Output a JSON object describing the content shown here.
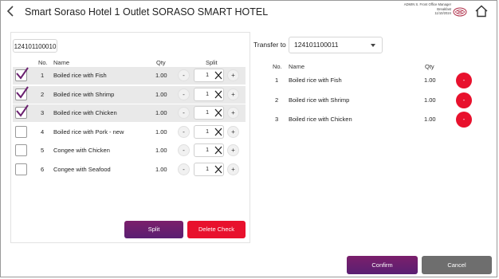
{
  "header": {
    "title": "Smart Soraso Hotel 1 Outlet SORASO SMART HOTEL",
    "user_line": "ADMIN S. Front Office Manager",
    "meal": "Breakfast",
    "date": "11/10/2024",
    "icons": {
      "back": "chevron-left-icon",
      "logo": "soraso-logo-icon",
      "home": "home-icon"
    }
  },
  "left": {
    "check_number": "124101100010",
    "columns": {
      "no": "No.",
      "name": "Name",
      "qty": "Qty",
      "split": "Split"
    },
    "rows": [
      {
        "no": "1",
        "name": "Boiled rice with Fish",
        "qty": "1.00",
        "split": "1",
        "checked": true
      },
      {
        "no": "2",
        "name": "Boiled rice with Shrimp",
        "qty": "1.00",
        "split": "1",
        "checked": true
      },
      {
        "no": "3",
        "name": "Boiled rice with Chicken",
        "qty": "1.00",
        "split": "1",
        "checked": true
      },
      {
        "no": "4",
        "name": "Boiled rice with Pork - new",
        "qty": "1.00",
        "split": "1",
        "checked": false
      },
      {
        "no": "5",
        "name": "Congee with Chicken",
        "qty": "1.00",
        "split": "1",
        "checked": false
      },
      {
        "no": "6",
        "name": "Congee with Seafood",
        "qty": "1.00",
        "split": "1",
        "checked": false
      }
    ],
    "minus_label": "-",
    "plus_label": "+",
    "split_button": "Split",
    "delete_button": "Delete Check"
  },
  "right": {
    "transfer_label": "Transfer to",
    "transfer_value": "124101100011",
    "columns": {
      "no": "No.",
      "name": "Name",
      "qty": "Qty"
    },
    "rows": [
      {
        "no": "1",
        "name": "Boiled rice with Fish",
        "qty": "1.00"
      },
      {
        "no": "2",
        "name": "Boiled rice with Shrimp",
        "qty": "1.00"
      },
      {
        "no": "3",
        "name": "Boiled rice with Chicken",
        "qty": "1.00"
      }
    ],
    "remove_label": "-"
  },
  "footer": {
    "confirm": "Confirm",
    "cancel": "Cancel"
  },
  "colors": {
    "primary": "#6a1f6f",
    "danger": "#e8112d",
    "neutral": "#6e6e6e",
    "selected_row": "#e9e9e9"
  }
}
